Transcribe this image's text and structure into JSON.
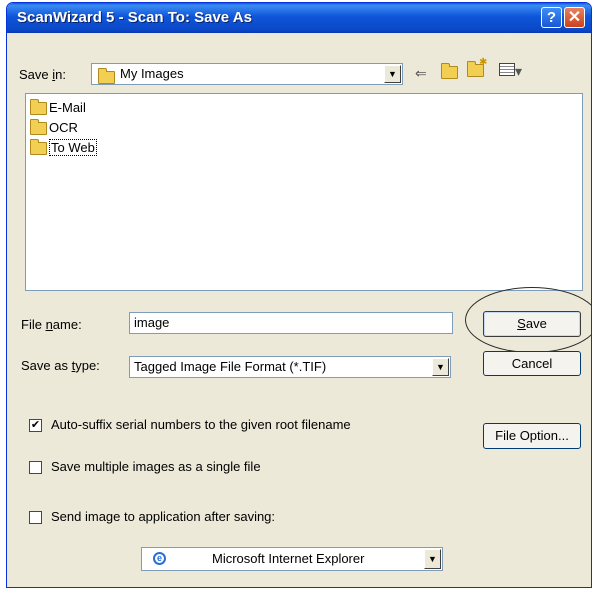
{
  "window": {
    "title": "ScanWizard 5 - Scan To: Save As",
    "help_icon": "question-icon",
    "close_icon": "close-icon"
  },
  "save_in": {
    "label_pre": "Save ",
    "label_accel": "i",
    "label_post": "n:",
    "value": "My Images"
  },
  "toolbar": {
    "back_icon": "back-arrow-icon",
    "up_icon": "up-folder-icon",
    "new_folder_icon": "new-folder-icon",
    "view_icon": "view-menu-icon"
  },
  "files": [
    {
      "name": "E-Mail"
    },
    {
      "name": "OCR"
    },
    {
      "name": "To Web"
    }
  ],
  "file_name": {
    "label_pre": "File ",
    "label_accel": "n",
    "label_post": "ame:",
    "value": "image"
  },
  "save_as_type": {
    "label_pre": "Save as ",
    "label_accel": "t",
    "label_post": "ype:",
    "value": "Tagged Image File Format (*.TIF)"
  },
  "buttons": {
    "save_accel": "S",
    "save_rest": "ave",
    "cancel": "Cancel",
    "file_option": "File Option..."
  },
  "options": {
    "auto_suffix": {
      "label": "Auto-suffix serial numbers to the given root filename",
      "checked": true
    },
    "multiple_images": {
      "label": "Save multiple images as a single file",
      "checked": false
    },
    "send_to_app": {
      "label": "Send image to application after saving:",
      "checked": false
    }
  },
  "application": {
    "value": "Microsoft Internet Explorer",
    "icon": "internet-explorer-icon"
  }
}
